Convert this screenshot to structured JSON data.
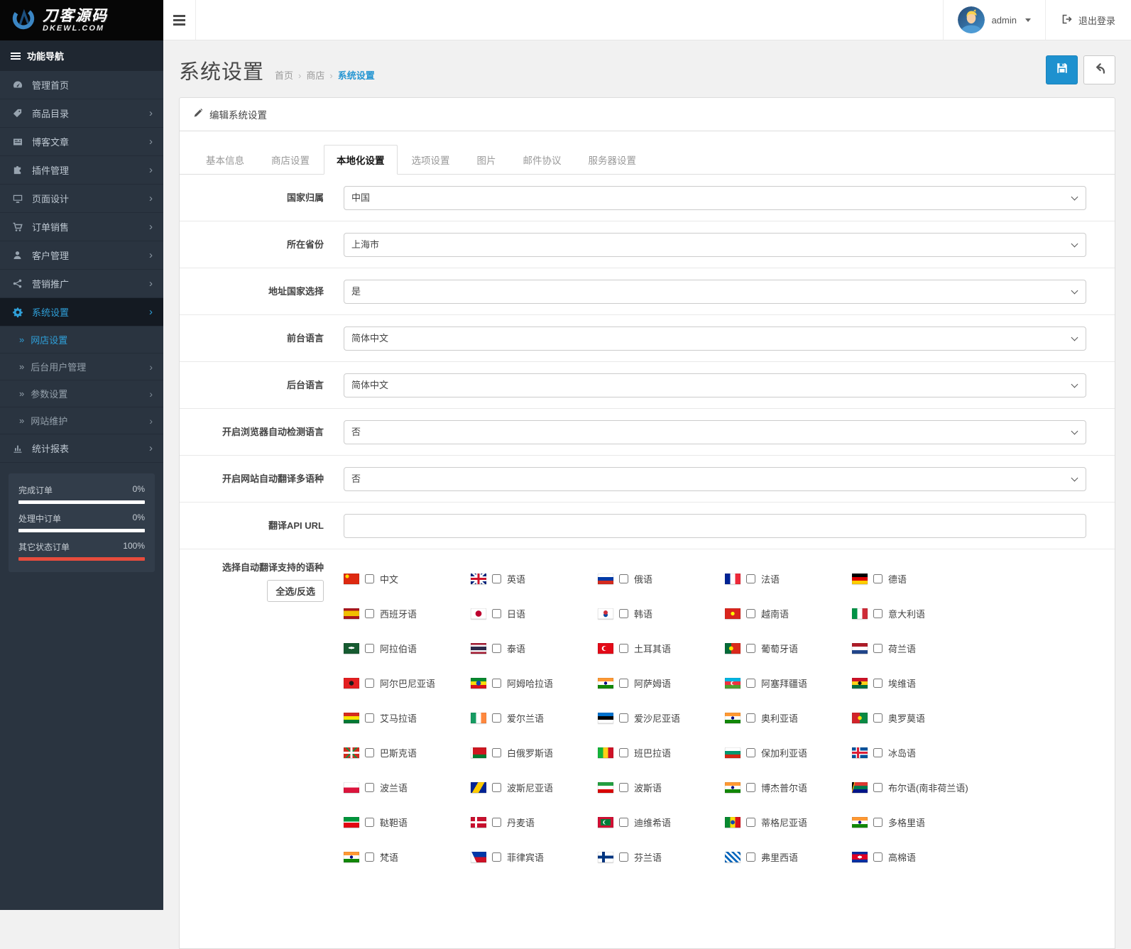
{
  "colors": {
    "accent": "#1e91cf",
    "link": "#2696d2",
    "sidebar": "#2a3440",
    "danger": "#e74c3c"
  },
  "header": {
    "logo_title": "刀客源码",
    "logo_subtitle": "DKEWL.COM",
    "username": "admin",
    "logout_label": "退出登录"
  },
  "sidebar": {
    "nav_title": "功能导航",
    "items": [
      {
        "label": "管理首页"
      },
      {
        "label": "商品目录"
      },
      {
        "label": "博客文章"
      },
      {
        "label": "插件管理"
      },
      {
        "label": "页面设计"
      },
      {
        "label": "订单销售"
      },
      {
        "label": "客户管理"
      },
      {
        "label": "营销推广"
      },
      {
        "label": "系统设置"
      }
    ],
    "system_children": [
      {
        "label": "网店设置"
      },
      {
        "label": "后台用户管理"
      },
      {
        "label": "参数设置"
      },
      {
        "label": "网站维护"
      }
    ],
    "reports_label": "统计报表",
    "stats": [
      {
        "label": "完成订单",
        "value": "0%",
        "pct": 0
      },
      {
        "label": "处理中订单",
        "value": "0%",
        "pct": 0
      },
      {
        "label": "其它状态订单",
        "value": "100%",
        "pct": 100
      }
    ]
  },
  "page": {
    "title": "系统设置",
    "breadcrumb": [
      "首页",
      "商店",
      "系统设置"
    ]
  },
  "panel": {
    "heading": "编辑系统设置",
    "tabs": [
      "基本信息",
      "商店设置",
      "本地化设置",
      "选项设置",
      "图片",
      "邮件协议",
      "服务器设置"
    ]
  },
  "form": {
    "fields": [
      {
        "label": "国家归属",
        "value": "中国"
      },
      {
        "label": "所在省份",
        "value": "上海市"
      },
      {
        "label": "地址国家选择",
        "value": "是"
      },
      {
        "label": "前台语言",
        "value": "简体中文"
      },
      {
        "label": "后台语言",
        "value": "简体中文"
      },
      {
        "label": "开启浏览器自动检测语言",
        "value": "否"
      },
      {
        "label": "开启网站自动翻译多语种",
        "value": "否"
      },
      {
        "label": "翻译API URL",
        "value": ""
      }
    ]
  },
  "languages": {
    "label": "选择自动翻译支持的语种",
    "toggle_all": "全选/反选",
    "items": [
      {
        "label": "中文",
        "flag": "cn"
      },
      {
        "label": "英语",
        "flag": "gb"
      },
      {
        "label": "俄语",
        "flag": "ru"
      },
      {
        "label": "法语",
        "flag": "fr"
      },
      {
        "label": "德语",
        "flag": "de"
      },
      {
        "label": "西班牙语",
        "flag": "es"
      },
      {
        "label": "日语",
        "flag": "jp"
      },
      {
        "label": "韩语",
        "flag": "kr"
      },
      {
        "label": "越南语",
        "flag": "vn"
      },
      {
        "label": "意大利语",
        "flag": "it"
      },
      {
        "label": "阿拉伯语",
        "flag": "arab"
      },
      {
        "label": "泰语",
        "flag": "th"
      },
      {
        "label": "土耳其语",
        "flag": "tr"
      },
      {
        "label": "葡萄牙语",
        "flag": "pt"
      },
      {
        "label": "荷兰语",
        "flag": "nl"
      },
      {
        "label": "阿尔巴尼亚语",
        "flag": "al"
      },
      {
        "label": "阿姆哈拉语",
        "flag": "eth"
      },
      {
        "label": "阿萨姆语",
        "flag": "in"
      },
      {
        "label": "阿塞拜疆语",
        "flag": "az"
      },
      {
        "label": "埃维语",
        "flag": "gh"
      },
      {
        "label": "艾马拉语",
        "flag": "bo"
      },
      {
        "label": "爱尔兰语",
        "flag": "ie"
      },
      {
        "label": "爱沙尼亚语",
        "flag": "est"
      },
      {
        "label": "奥利亚语",
        "flag": "in"
      },
      {
        "label": "奥罗莫语",
        "flag": "om"
      },
      {
        "label": "巴斯克语",
        "flag": "eus"
      },
      {
        "label": "白俄罗斯语",
        "flag": "by"
      },
      {
        "label": "班巴拉语",
        "flag": "ml"
      },
      {
        "label": "保加利亚语",
        "flag": "bg"
      },
      {
        "label": "冰岛语",
        "flag": "is"
      },
      {
        "label": "波兰语",
        "flag": "pl"
      },
      {
        "label": "波斯尼亚语",
        "flag": "ba"
      },
      {
        "label": "波斯语",
        "flag": "ir"
      },
      {
        "label": "博杰普尔语",
        "flag": "in"
      },
      {
        "label": "布尔语(南非荷兰语)",
        "flag": "za"
      },
      {
        "label": "鞑靼语",
        "flag": "tat"
      },
      {
        "label": "丹麦语",
        "flag": "dk"
      },
      {
        "label": "迪维希语",
        "flag": "mv"
      },
      {
        "label": "蒂格尼亚语",
        "flag": "er"
      },
      {
        "label": "多格里语",
        "flag": "in"
      },
      {
        "label": "梵语",
        "flag": "in"
      },
      {
        "label": "菲律宾语",
        "flag": "ph"
      },
      {
        "label": "芬兰语",
        "flag": "fi"
      },
      {
        "label": "弗里西语",
        "flag": "fy"
      },
      {
        "label": "高棉语",
        "flag": "kh"
      }
    ]
  }
}
